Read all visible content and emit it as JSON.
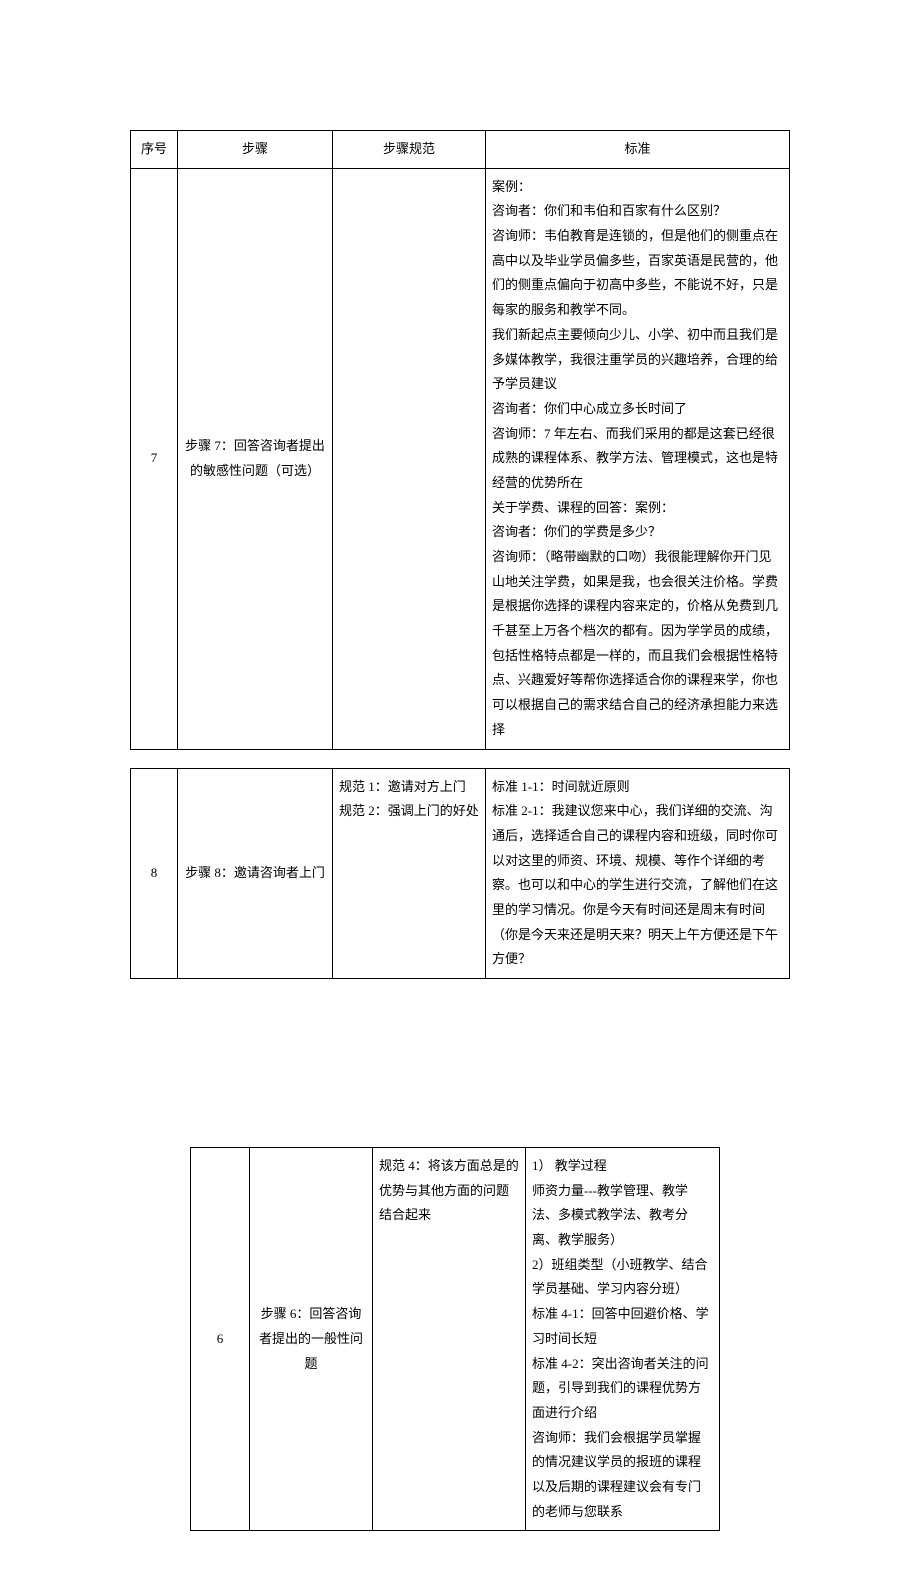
{
  "headers": {
    "seq": "序号",
    "step": "步骤",
    "spec": "步骤规范",
    "std": "标准"
  },
  "row7": {
    "num": "7",
    "step": "步骤 7：回答咨询者提出的敏感性问题（可选）",
    "spec": "",
    "std_line1": "案例：",
    "std_line2": "咨询者：你们和韦伯和百家有什么区别？",
    "std_line3": "咨询师：韦伯教育是连锁的，但是他们的侧重点在高中以及毕业学员偏多些，百家英语是民营的，他们的侧重点偏向于初高中多些，不能说不好，只是每家的服务和教学不同。",
    "std_line4": "我们新起点主要倾向少儿、小学、初中而且我们是多媒体教学，我很注重学员的兴趣培养，合理的给予学员建议",
    "std_line5": "咨询者：你们中心成立多长时间了",
    "std_line6": "咨询师：7 年左右、而我们采用的都是这套已经很成熟的课程体系、教学方法、管理模式，这也是特经营的优势所在",
    "std_line7": "关于学费、课程的回答：案例：",
    "std_line8": "咨询者：你们的学费是多少？",
    "std_line9": "咨询师：（略带幽默的口吻）我很能理解你开门见山地关注学费，如果是我，也会很关注价格。学费是根据你选择的课程内容来定的，价格从免费到几千甚至上万各个档次的都有。因为学学员的成绩，包括性格特点都是一样的，而且我们会根据性格特点、兴趣爱好等帮你选择适合你的课程来学，你也可以根据自己的需求结合自己的经济承担能力来选择"
  },
  "row8": {
    "num": "8",
    "step": "步骤 8：邀请咨询者上门",
    "spec_l1": "规范 1：邀请对方上门",
    "spec_l2": "规范 2：强调上门的好处",
    "std_l1": "标准 1-1：时间就近原则",
    "std_l2": "标准 2-1：我建议您来中心，我们详细的交流、沟通后，选择适合自己的课程内容和班级，同时你可以对这里的师资、环境、规模、等作个详细的考察。也可以和中心的学生进行交流，了解他们在这里的学习情况。你是今天有时间还是周末有时间（你是今天来还是明天来？明天上午方便还是下午方便？"
  },
  "row6": {
    "num": "6",
    "step": "步骤 6：回答咨询者提出的一般性问题",
    "spec": "规范 4：将该方面总是的优势与其他方面的问题结合起来",
    "std_l1": "1）  教学过程",
    "std_l2": "师资力量---教学管理、教学法、多模式教学法、教考分离、教学服务）",
    "std_l3": "2）班组类型（小班教学、结合学员基础、学习内容分班）",
    "std_l4": "标准 4-1：回答中回避价格、学习时间长短",
    "std_l5": "标准 4-2：突出咨询者关注的问题，引导到我们的课程优势方面进行介绍",
    "std_l6": "咨询师：我们会根据学员掌握的情况建议学员的报班的课程以及后期的课程建议会有专门的老师与您联系"
  }
}
